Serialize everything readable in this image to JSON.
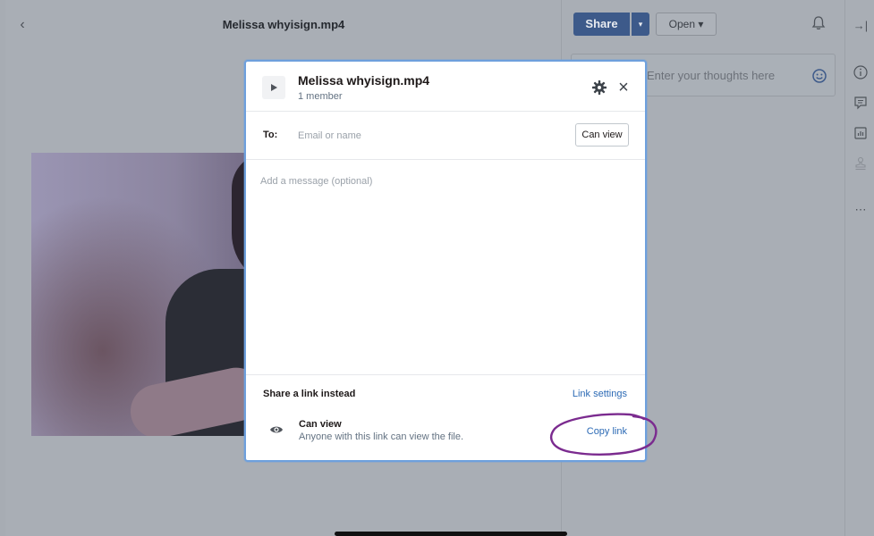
{
  "background": {
    "video_title": "Melissa whyisign.mp4",
    "share_label": "Share",
    "open_label": "Open ▾",
    "comment_placeholder": "Enter your thoughts here",
    "rail_icons": [
      "collapse-panel-icon",
      "info-icon",
      "comment-icon",
      "stats-icon",
      "stamp-icon",
      "more-icon"
    ]
  },
  "modal": {
    "title": "Melissa whyisign.mp4",
    "subtitle": "1 member",
    "to_label": "To:",
    "to_placeholder": "Email or name",
    "permission_button": "Can view",
    "message_placeholder": "Add a message (optional)",
    "link_heading": "Share a link instead",
    "link_settings": "Link settings",
    "link_permission_title": "Can view",
    "link_permission_desc": "Anyone with this link can view the file.",
    "copy_link": "Copy link"
  },
  "colors": {
    "accent": "#2c6ab5",
    "share_button": "#3d5a8a",
    "annotation": "#7b2b8f",
    "modal_border": "#6ea0dd"
  }
}
